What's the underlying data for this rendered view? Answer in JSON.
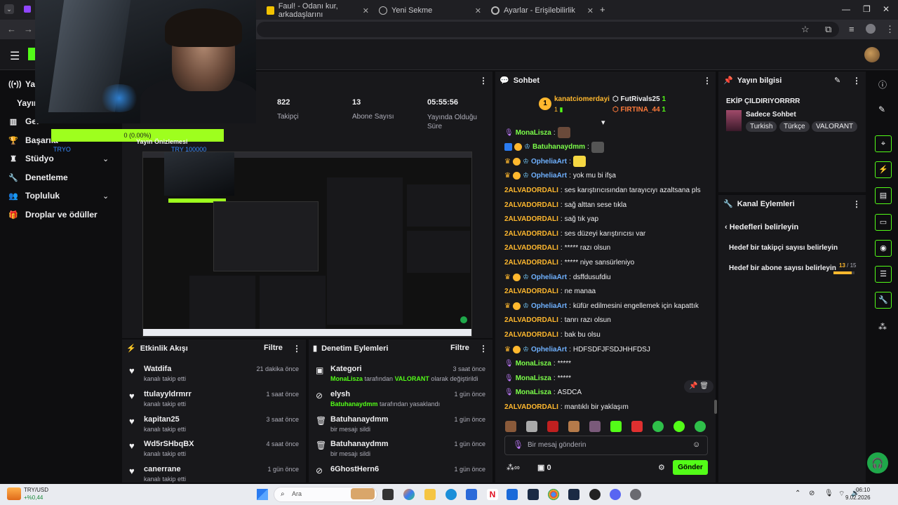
{
  "browser": {
    "tabs": [
      {
        "label": "Faul! - Odanı kur, arkadaşlarını"
      },
      {
        "label": "Yeni Sekme"
      },
      {
        "label": "Ayarlar - Erişilebilirlik"
      }
    ]
  },
  "sidebar": {
    "items": [
      {
        "label": "Yayın",
        "icon": "broadcast-icon"
      },
      {
        "label": "Yayın",
        "icon": ""
      },
      {
        "label": "Gel",
        "icon": "chart-icon"
      },
      {
        "label": "Başarıla",
        "icon": "trophy-icon"
      },
      {
        "label": "Stüdyo",
        "icon": "studio-icon"
      },
      {
        "label": "Denetleme",
        "icon": "wrench-icon"
      },
      {
        "label": "Topluluk",
        "icon": "people-icon"
      },
      {
        "label": "Droplar ve ödüller",
        "icon": "gift-icon"
      }
    ]
  },
  "overlay": {
    "goal_text": "0 (0.00%)",
    "cam_text_a": "TRYO",
    "cam_text_b": "TRY 100000",
    "preview_title": "Yayın Önizlemesi"
  },
  "stats": [
    {
      "value": "822",
      "label": "Takipçi"
    },
    {
      "value": "13",
      "label": "Abone Sayısı"
    },
    {
      "value": "05:55:56",
      "label": "Yayında Olduğu Süre"
    }
  ],
  "activity": {
    "title": "Etkinlik Akışı",
    "filter": "Filtre",
    "items": [
      {
        "name": "Watdifa",
        "sub": "kanalı takip etti",
        "time": "21 dakika önce"
      },
      {
        "name": "ttulayyldrmrr",
        "sub": "kanalı takip etti",
        "time": "1 saat önce"
      },
      {
        "name": "kapitan25",
        "sub": "kanalı takip etti",
        "time": "3 saat önce"
      },
      {
        "name": "Wd5rSHbqBX",
        "sub": "kanalı takip etti",
        "time": "4 saat önce"
      },
      {
        "name": "canerrane",
        "sub": "kanalı takip etti",
        "time": "1 gün önce"
      }
    ]
  },
  "moderation": {
    "title": "Denetim Eylemleri",
    "filter": "Filtre",
    "items": [
      {
        "name": "Kategori",
        "actor": "MonaLisza",
        "mid": " tarafından ",
        "target": "VALORANT",
        "tail": " olarak değiştirildi",
        "time": "3 saat önce"
      },
      {
        "name": "elysh",
        "actor": "Batuhanaydmm",
        "mid": " tarafından yasaklandı",
        "target": "",
        "tail": "",
        "time": "1 gün önce"
      },
      {
        "name": "Batuhanaydmm",
        "actor": "",
        "mid": "bir mesajı sildi",
        "target": "",
        "tail": "",
        "time": "1 gün önce"
      },
      {
        "name": "Batuhanaydmm",
        "actor": "",
        "mid": "bir mesajı sildi",
        "target": "",
        "tail": "",
        "time": "1 gün önce"
      },
      {
        "name": "6GhostHern6",
        "actor": "",
        "mid": "",
        "target": "",
        "tail": "",
        "time": "1 gün önce"
      }
    ]
  },
  "chat": {
    "title": "Sohbet",
    "top": [
      {
        "rank": "1",
        "name": "kanatciomerdayi",
        "count": "1"
      },
      {
        "name": "FutRivals25",
        "count": "1"
      },
      {
        "name": "FIRTINA_44",
        "count": "1"
      }
    ],
    "messages": [
      {
        "user": "MonaLisza",
        "type": "mona",
        "text": ""
      },
      {
        "user": "Batuhanaydmm",
        "type": "mod",
        "text": ""
      },
      {
        "user": "OpheliaArt",
        "type": "vip",
        "text": ""
      },
      {
        "user": "OpheliaArt",
        "type": "vip",
        "text": "yok mu bi ifşa"
      },
      {
        "user": "2ALVADORDALI",
        "type": "plain",
        "text": "ses karıştırıcısından tarayıcıyı azaltsana pls"
      },
      {
        "user": "2ALVADORDALI",
        "type": "plain",
        "text": "sağ alttan sese tıkla"
      },
      {
        "user": "2ALVADORDALI",
        "type": "plain",
        "text": "sağ tık yap"
      },
      {
        "user": "2ALVADORDALI",
        "type": "plain",
        "text": "ses düzeyi karıştırıcısı var"
      },
      {
        "user": "2ALVADORDALI",
        "type": "plain",
        "text": "***** razı olsun"
      },
      {
        "user": "2ALVADORDALI",
        "type": "plain",
        "text": "***** niye sansürleniyo"
      },
      {
        "user": "OpheliaArt",
        "type": "vip",
        "text": "dsffdusufdiu"
      },
      {
        "user": "2ALVADORDALI",
        "type": "plain",
        "text": "ne manaa"
      },
      {
        "user": "OpheliaArt",
        "type": "vip",
        "text": "küfür edilmesini engellemek için kapattık"
      },
      {
        "user": "2ALVADORDALI",
        "type": "plain",
        "text": "tanrı razı olsun"
      },
      {
        "user": "2ALVADORDALI",
        "type": "plain",
        "text": "bak bu olsu"
      },
      {
        "user": "OpheliaArt",
        "type": "vip",
        "text": "HDFSDFJFSDJHHFDSJ"
      },
      {
        "user": "MonaLisza",
        "type": "mona",
        "text": "*****"
      },
      {
        "user": "MonaLisza",
        "type": "mona",
        "text": "*****"
      },
      {
        "user": "MonaLisza",
        "type": "mona",
        "text": "ASDCA"
      },
      {
        "user": "2ALVADORDALI",
        "type": "plain",
        "text": "mantıklı bir yaklaşım"
      }
    ],
    "input_placeholder": "Bir mesaj gönderin",
    "points": "0",
    "send": "Gönder"
  },
  "stream_info": {
    "title": "Yayın bilgisi",
    "stream_title": "EKİP ÇILDIRIYORRRR",
    "category": "Sadece Sohbet",
    "tags": [
      "Turkish",
      "Türkçe",
      "VALORANT"
    ]
  },
  "channel_actions": {
    "title": "Kanal Eylemleri",
    "back": "Hedefleri belirleyin",
    "items": [
      {
        "label": "Hedef bir takipçi sayısı belirleyin"
      },
      {
        "label": "Hedef bir abone sayısı belirleyin",
        "progress": "13",
        "total": "/ 15",
        "fraction": 0.867
      }
    ]
  },
  "taskbar": {
    "stock": "TRY/USD",
    "stock_change": "+%0,44",
    "search": "Ara",
    "time": "06:10",
    "date": "9.02.2026"
  },
  "colors": {
    "accent": "#53fc18",
    "bg": "#0e0e10",
    "panel": "#18181b"
  }
}
